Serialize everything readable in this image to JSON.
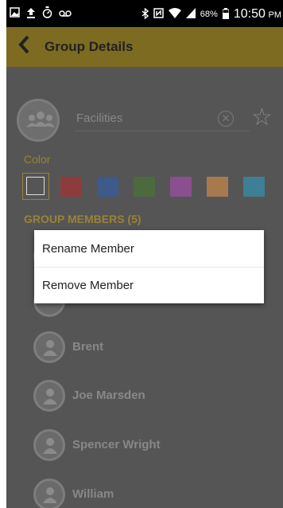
{
  "status_bar": {
    "battery": "68%",
    "time": "10:50",
    "am_pm": "PM"
  },
  "header": {
    "title": "Group Details"
  },
  "group": {
    "name": "Facilities"
  },
  "colors": {
    "label": "Color",
    "swatches": [
      "#555555",
      "#8e3b3b",
      "#3c5a8a",
      "#4d6a3e",
      "#8a4f8e",
      "#a77a4d",
      "#3d7f94"
    ],
    "accent": "#9a8335"
  },
  "members": {
    "label": "GROUP MEMBERS (5)",
    "items": [
      "Brent",
      "Joe Marsden",
      "Spencer Wright",
      "William"
    ]
  },
  "context_menu": {
    "rename_label": "Rename Member",
    "remove_label": "Remove Member"
  }
}
